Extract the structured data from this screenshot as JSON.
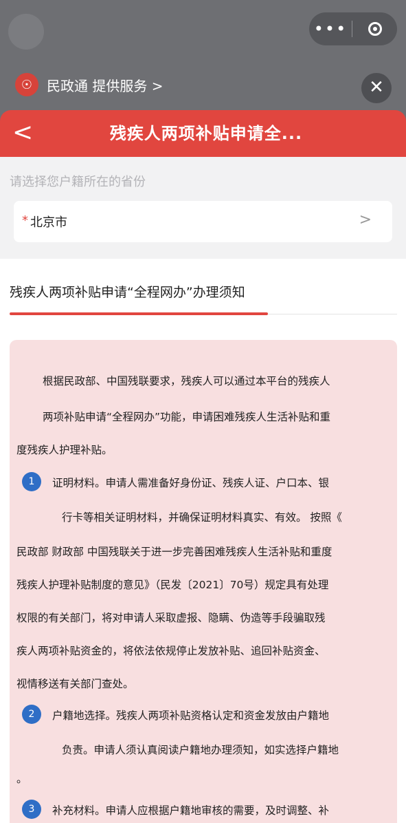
{
  "capsule": {
    "more_icon": "more-dots-icon",
    "close_icon": "target-icon"
  },
  "service": {
    "logo_icon": "emblem-icon",
    "text": "民政通 提供服务 >",
    "close": "✕"
  },
  "header": {
    "back": "<",
    "title": "残疾人两项补贴申请全..."
  },
  "prompt": "请选择您户籍所在的省份",
  "province": {
    "required_mark": "*",
    "value": "北京市",
    "chevron": ">"
  },
  "notice": {
    "title": "残疾人两项补贴申请“全程网办”办理须知",
    "lines": [
      "根据民政部、中国残联要求，残疾人可以通过本平台的残疾人",
      "两项补贴申请“全程网办”功能，申请困难残疾人生活补贴和重",
      "度残疾人护理补贴。",
      "证明材料。申请人需准备好身份证、残疾人证、户口本、银",
      "行卡等相关证明材料，并确保证明材料真实、有效。 按照《",
      "民政部 财政部 中国残联关于进一步完善困难残疾人生活补贴和重度",
      "残疾人护理补贴制度的意见》（民发〔2021〕70号）规定具有处理",
      "权限的有关部门，将对申请人采取虚报、隐瞒、伪造等手段骗取残",
      "疾人两项补贴资金的，将依法依规停止发放补贴、追回补贴资金、",
      "视情移送有关部门查处。",
      "户籍地选择。残疾人两项补贴资格认定和资金发放由户籍地",
      "负责。申请人须认真阅读户籍地办理须知，如实选择户籍地",
      "。",
      "补充材料。申请人应根据户籍地审核的需要，及时调整、补"
    ],
    "numbers": [
      "1",
      "2",
      "3"
    ]
  },
  "colors": {
    "accent": "#e1463f",
    "number_badge": "#2f6ec6",
    "notice_bg": "#f8dfe0"
  }
}
